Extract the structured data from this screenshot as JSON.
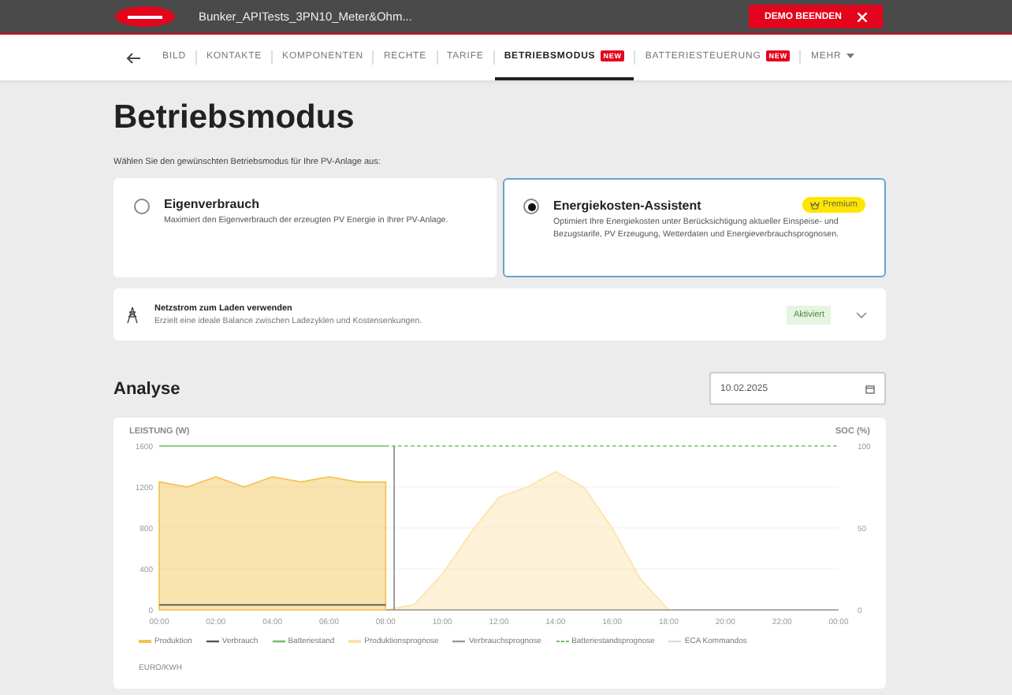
{
  "topbar": {
    "system_name": "Bunker_APITests_3PN10_Meter&Ohm...",
    "end_demo_button": "DEMO BEENDEN"
  },
  "nav": {
    "tabs": [
      {
        "label": "BILD",
        "selected": false
      },
      {
        "label": "KONTAKTE",
        "selected": false
      },
      {
        "label": "KOMPONENTEN",
        "selected": false
      },
      {
        "label": "RECHTE",
        "selected": false
      },
      {
        "label": "TARIFE",
        "selected": false
      },
      {
        "label": "BETRIEBSMODUS",
        "selected": true,
        "badge": "NEW"
      },
      {
        "label": "BATTERIESTEUERUNG",
        "selected": false,
        "badge": "NEW"
      },
      {
        "label": "MEHR",
        "selected": false,
        "dropdown": true
      }
    ]
  },
  "page_title": "Betriebsmodus",
  "intro": "Wählen Sie den gewünschten Betriebsmodus für Ihre PV-Anlage aus:",
  "modes": [
    {
      "title": "Eigenverbrauch",
      "description": "Maximiert den Eigenverbrauch der erzeugten PV Energie in Ihrer PV-Anlage.",
      "selected": false
    },
    {
      "title": "Energiekosten-Assistent",
      "description": "Optimiert Ihre Energiekosten unter Berücksichtigung aktueller Einspeise- und Bezugstarife, PV Erzeugung, Wetterdaten und Energieverbrauchsprognosen.",
      "selected": true,
      "badge": "Premium"
    }
  ],
  "grid_charging": {
    "title": "Netzstrom zum Laden verwenden",
    "description": "Erzielt eine ideale Balance zwischen Ladezyklen und Kostensenkungen.",
    "status": "Aktiviert",
    "expanded": false
  },
  "analysis": {
    "title": "Analyse",
    "date": "10.02.2025",
    "chart_data": {
      "type": "line",
      "ylabel": "LEISTUNG (W)",
      "y2label": "SOC (%)",
      "y2lim": [
        0,
        100
      ],
      "y2ticks": [
        0,
        50,
        100
      ],
      "grid": true,
      "legend": "bottom",
      "ref_lines": [
        {
          "axis": "x",
          "value": 8.3,
          "color": "#888888"
        }
      ],
      "x": [
        0,
        1,
        2,
        3,
        4,
        5,
        6,
        7,
        8,
        9,
        10,
        11,
        12,
        13,
        14,
        15,
        16,
        17,
        18,
        19,
        20,
        21,
        22,
        23,
        24
      ],
      "xlim": [
        0,
        24
      ],
      "ylim": [
        0,
        1600
      ],
      "yticks": [
        0,
        400,
        800,
        1200,
        1600
      ],
      "xticks": [
        {
          "value": 0,
          "label": "00:00"
        },
        {
          "value": 2,
          "label": "02:00"
        },
        {
          "value": 4,
          "label": "04:00"
        },
        {
          "value": 6,
          "label": "06:00"
        },
        {
          "value": 8,
          "label": "08:00"
        },
        {
          "value": 10,
          "label": "10:00"
        },
        {
          "value": 12,
          "label": "12:00"
        },
        {
          "value": 14,
          "label": "14:00"
        },
        {
          "value": 16,
          "label": "16:00"
        },
        {
          "value": 18,
          "label": "18:00"
        },
        {
          "value": 20,
          "label": "20:00"
        },
        {
          "value": 22,
          "label": "22:00"
        },
        {
          "value": 24,
          "label": "00:00"
        }
      ],
      "series": [
        {
          "name": "Produktion",
          "color": "#f2c14e",
          "type": "area",
          "values": [
            1250,
            1200,
            1300,
            1200,
            1300,
            1250,
            1300,
            1250,
            1250,
            null,
            null,
            null,
            null,
            null,
            null,
            null,
            null,
            null,
            null,
            null,
            null,
            null,
            null,
            null,
            null
          ]
        },
        {
          "name": "Verbrauch",
          "color": "#555555",
          "type": "line",
          "values": [
            50,
            50,
            50,
            50,
            50,
            50,
            50,
            50,
            50,
            null,
            null,
            null,
            null,
            null,
            null,
            null,
            null,
            null,
            null,
            null,
            null,
            null,
            null,
            null,
            null
          ]
        },
        {
          "name": "Batteriestand",
          "color": "#6abf5e",
          "type": "line",
          "axis": "y2",
          "values": [
            100,
            100,
            100,
            100,
            100,
            100,
            100,
            100,
            100,
            null,
            null,
            null,
            null,
            null,
            null,
            null,
            null,
            null,
            null,
            null,
            null,
            null,
            null,
            null,
            null
          ]
        },
        {
          "name": "Produktionsprognose",
          "color": "#fbe3a6",
          "type": "area",
          "values": [
            null,
            null,
            null,
            null,
            null,
            null,
            null,
            null,
            0,
            50,
            350,
            750,
            1100,
            1200,
            1350,
            1200,
            800,
            300,
            0,
            0,
            0,
            0,
            0,
            0,
            0
          ]
        },
        {
          "name": "Verbrauchsprognose",
          "color": "#999999",
          "type": "line",
          "values": [
            null,
            null,
            null,
            null,
            null,
            null,
            null,
            null,
            0,
            0,
            0,
            0,
            0,
            0,
            0,
            0,
            0,
            0,
            0,
            0,
            0,
            0,
            0,
            0,
            0
          ]
        },
        {
          "name": "Batteriestandsprognose",
          "color": "#6abf5e",
          "type": "line",
          "line_style": "dashed",
          "axis": "y2",
          "values": [
            null,
            null,
            null,
            null,
            null,
            null,
            null,
            null,
            100,
            100,
            100,
            100,
            100,
            100,
            100,
            100,
            100,
            100,
            100,
            100,
            100,
            100,
            100,
            100,
            100
          ]
        },
        {
          "name": "ECA Kommandos",
          "color": "#dddddd",
          "type": "line",
          "values": [
            null,
            null,
            null,
            null,
            null,
            null,
            null,
            null,
            null,
            null,
            null,
            null,
            null,
            null,
            null,
            null,
            null,
            null,
            null,
            null,
            null,
            null,
            null,
            null,
            null
          ]
        }
      ]
    },
    "price_axis_label": "EURO/KWH"
  }
}
